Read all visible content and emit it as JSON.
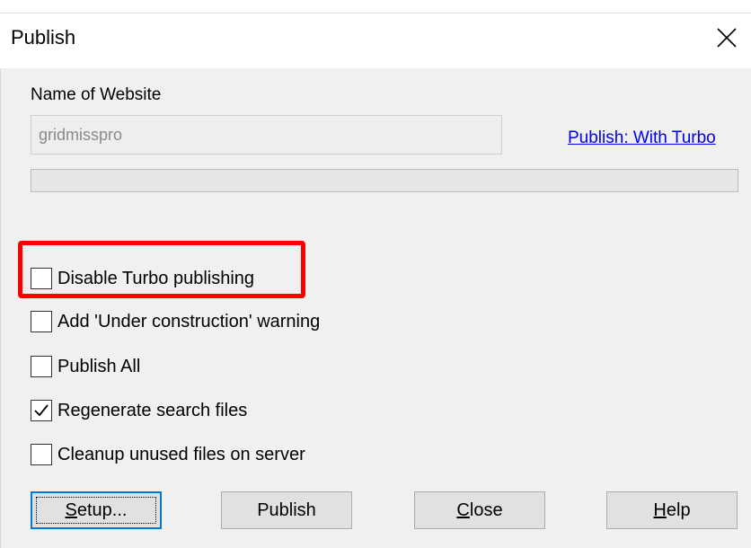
{
  "window": {
    "title": "Publish",
    "close_glyph": "✕"
  },
  "form": {
    "name_label": "Name of Website",
    "name_value": "gridmisspro",
    "publish_link": "Publish: With Turbo",
    "progress_percent": 0
  },
  "options": [
    {
      "label": "Disable Turbo publishing",
      "checked": false
    },
    {
      "label": "Add 'Under construction' warning",
      "checked": false
    },
    {
      "label": "Publish All",
      "checked": false
    },
    {
      "label": "Regenerate search files",
      "checked": true
    },
    {
      "label": "Cleanup unused files on server",
      "checked": false
    }
  ],
  "buttons": {
    "setup": {
      "mnemonic": "S",
      "rest": "etup..."
    },
    "publish": {
      "label": "Publish"
    },
    "close": {
      "mnemonic": "C",
      "rest": "lose"
    },
    "help": {
      "mnemonic": "H",
      "rest": "elp"
    }
  },
  "annotation": {
    "color": "#ff0000",
    "target": "Disable Turbo publishing"
  }
}
